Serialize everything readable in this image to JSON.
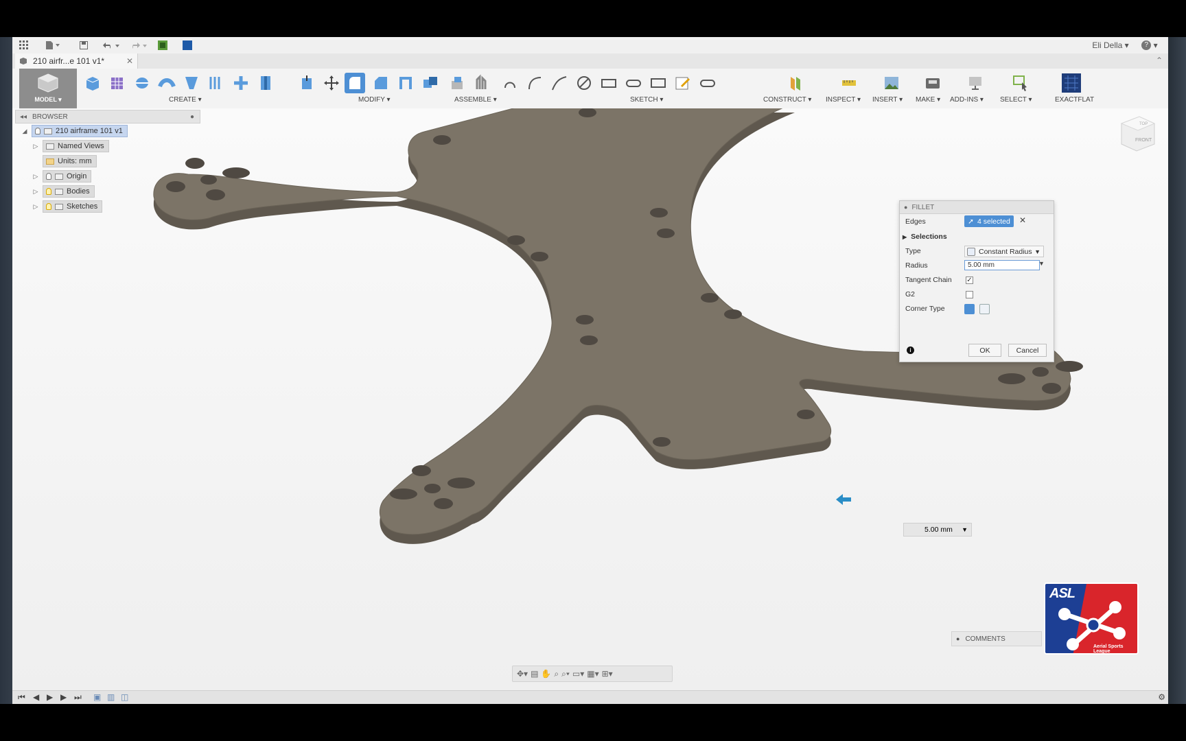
{
  "app": {
    "user": "Eli Della",
    "help": "?",
    "doc_tab": "210 airfr...e 101 v1*"
  },
  "ribbon": {
    "model_label": "MODEL ▾",
    "groups": {
      "create": "CREATE ▾",
      "modify": "MODIFY ▾",
      "assemble": "ASSEMBLE ▾",
      "sketch": "SKETCH ▾",
      "construct": "CONSTRUCT ▾",
      "inspect": "INSPECT ▾",
      "insert": "INSERT ▾",
      "make": "MAKE ▾",
      "addins": "ADD-INS ▾",
      "select": "SELECT ▾",
      "exactflat": "EXACTFLAT"
    }
  },
  "browser": {
    "title": "BROWSER",
    "root": "210 airframe 101 v1",
    "items": [
      "Named Views",
      "Units: mm",
      "Origin",
      "Bodies",
      "Sketches"
    ]
  },
  "fillet": {
    "title": "FILLET",
    "edges_label": "Edges",
    "edges_value": "4 selected",
    "selections_label": "Selections",
    "type_label": "Type",
    "type_value": "Constant Radius",
    "radius_label": "Radius",
    "radius_value": "5.00 mm",
    "tangent_label": "Tangent Chain",
    "tangent_checked": true,
    "g2_label": "G2",
    "g2_checked": false,
    "corner_label": "Corner Type",
    "ok": "OK",
    "cancel": "Cancel"
  },
  "float_radius": "5.00 mm",
  "comments": "COMMENTS",
  "viewcube": {
    "top": "TOP",
    "front": "FRONT"
  },
  "logo": {
    "title": "ASL",
    "subtitle": "Aerial Sports League"
  },
  "colors": {
    "part": "#7c7467",
    "part_edge": "#5f584e",
    "accent": "#4d8fd4"
  }
}
